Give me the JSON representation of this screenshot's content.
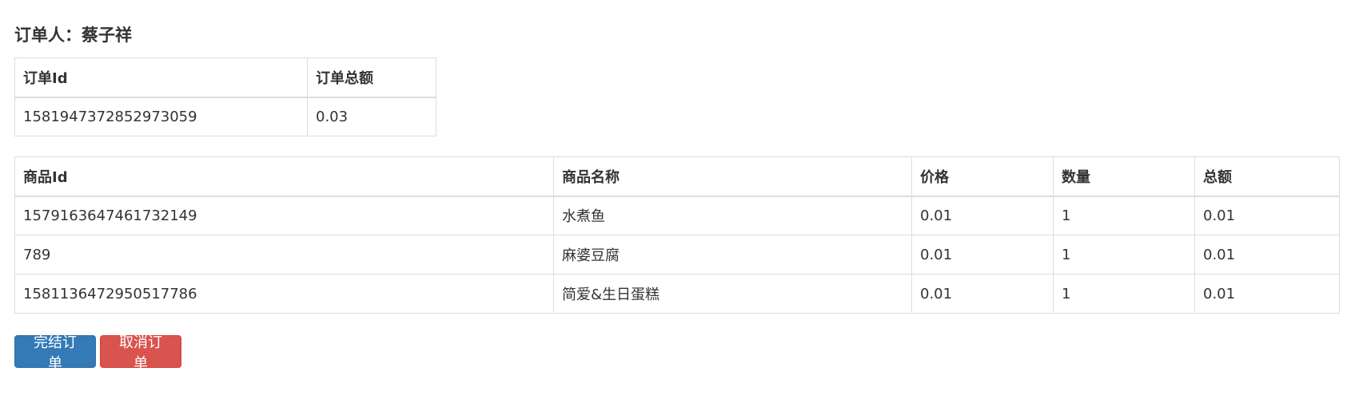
{
  "orderer": {
    "label": "订单人：蔡子祥"
  },
  "order_table": {
    "headers": [
      "订单Id",
      "订单总额"
    ],
    "rows": [
      [
        "1581947372852973059",
        "0.03"
      ]
    ]
  },
  "items_table": {
    "headers": [
      "商品Id",
      "商品名称",
      "价格",
      "数量",
      "总额"
    ],
    "rows": [
      [
        "1579163647461732149",
        "水煮鱼",
        "0.01",
        "1",
        "0.01"
      ],
      [
        "789",
        "麻婆豆腐",
        "0.01",
        "1",
        "0.01"
      ],
      [
        "1581136472950517786",
        "简爱&生日蛋糕",
        "0.01",
        "1",
        "0.01"
      ]
    ]
  },
  "actions": {
    "complete_label": "完结订单",
    "cancel_label": "取消订单"
  },
  "colors": {
    "primary": "#337ab7",
    "danger": "#d9534f",
    "border": "#dddddd",
    "text": "#333333"
  }
}
